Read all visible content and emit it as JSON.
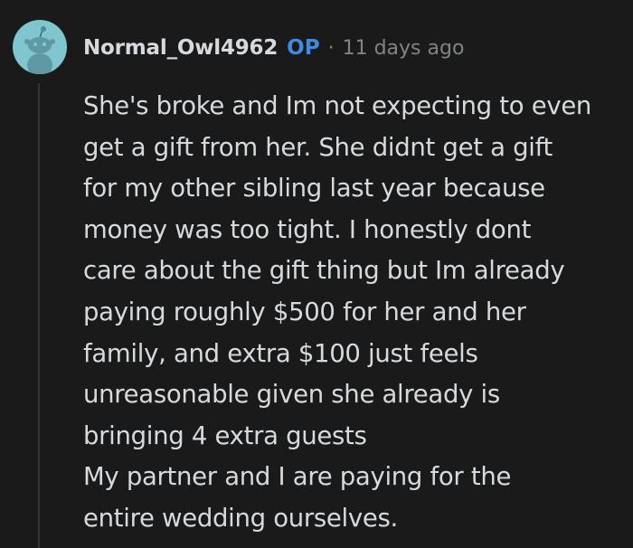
{
  "comment": {
    "author": "Normal_Owl4962",
    "op_badge": "OP",
    "separator": "·",
    "timestamp": "11 days ago",
    "avatar_icon": "snoo-avatar-icon",
    "body_lines": [
      "She's broke and Im not expecting to even",
      "get a gift from her. She didnt get a gift",
      "for my other sibling last year because",
      "money was too tight. I honestly dont",
      "care about the gift thing but Im already",
      "paying roughly $500 for her and her",
      "family, and extra $100 just feels",
      "unreasonable given she already is",
      "bringing 4 extra guests",
      "My partner and I are paying for the",
      "entire wedding ourselves."
    ]
  },
  "colors": {
    "background": "#1a1a1b",
    "text": "#d7dadc",
    "meta": "#818384",
    "op_accent": "#3d8be3",
    "avatar_bg": "#7fc6cf"
  }
}
